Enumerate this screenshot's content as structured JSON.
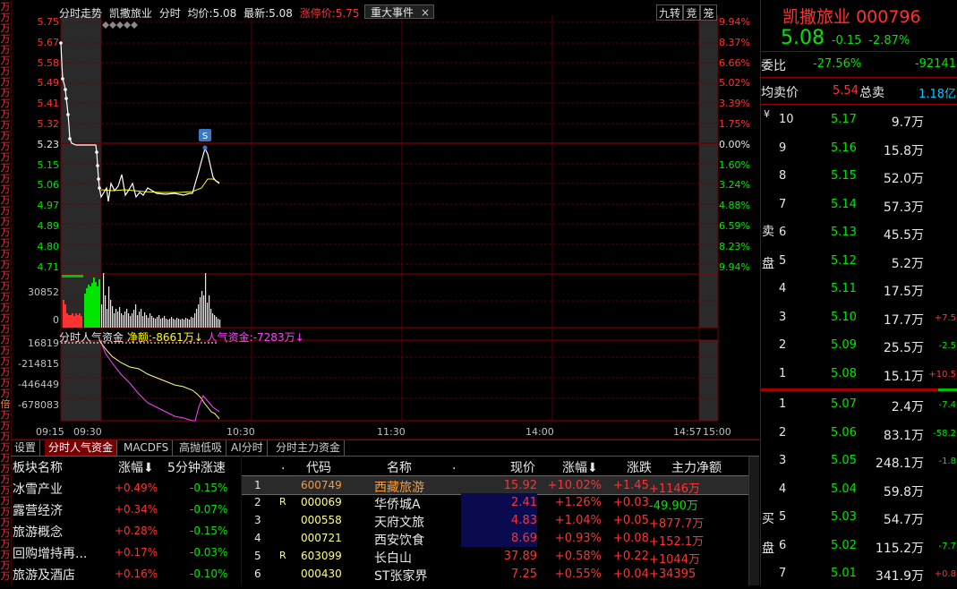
{
  "left_strip": [
    "万",
    "万",
    "万",
    "万",
    "万",
    "万",
    "万",
    "万",
    "万",
    "万",
    "万",
    "万",
    "万",
    "万",
    "万",
    "万",
    "万",
    "万",
    "万",
    "万",
    "万",
    "万",
    "万",
    "万",
    "万",
    "万",
    "万",
    "万",
    "万",
    "万",
    "万",
    "万",
    "万",
    "万",
    "万",
    "万",
    "万",
    "倍",
    "万",
    "万",
    "万",
    "万",
    "万",
    "万",
    "万",
    "万",
    "万",
    "万",
    "万",
    "万",
    "万",
    "万",
    "万",
    "万"
  ],
  "header": {
    "view": "分时走势",
    "stock_name": "凯撒旅业",
    "mode": "分时",
    "avg_label": "均价:",
    "avg_value": "5.08",
    "last_label": "最新:",
    "last_value": "5.08",
    "limit_label": "涨停价:",
    "limit_value": "5.75"
  },
  "event_tab": {
    "label": "重大事件",
    "close": "×"
  },
  "top_buttons": [
    "九转",
    "竞",
    "笼"
  ],
  "price_axis": [
    "5.75",
    "5.67",
    "5.58",
    "5.49",
    "5.41",
    "5.32",
    "5.23",
    "5.15",
    "5.06",
    "4.97",
    "4.89",
    "4.80",
    "4.71"
  ],
  "pct_axis": [
    "9.94%",
    "8.37%",
    "6.66%",
    "5.02%",
    "3.39%",
    "1.75%",
    "0.00%",
    "1.60%",
    "3.24%",
    "4.88%",
    "6.59%",
    "8.23%",
    "9.94%"
  ],
  "volume_axis": [
    "30852",
    "0"
  ],
  "signal_marker": "S",
  "fund_header": {
    "title": "分时人气资金",
    "net_label": "净额:",
    "net_value": "-8661万↓",
    "pop_label": "人气资金:",
    "pop_value": "-7283万↓"
  },
  "fund_axis": [
    "16819",
    "-214815",
    "-446449",
    "-678083"
  ],
  "time_axis": [
    "09:15",
    "09:30",
    "10:30",
    "11:30",
    "14:00",
    "14:57",
    "15:00"
  ],
  "quote": {
    "name": "凯撒旅业",
    "code": "000796",
    "price": "5.08",
    "change": "-0.15",
    "change_pct": "-2.87%",
    "weibi_label": "委比",
    "weibi_value": "-27.56%",
    "weicha_value": "-92141",
    "avg_sell_label": "均卖价",
    "avg_sell_value": "5.54",
    "total_sell_label": "总卖",
    "total_sell_value": "1.18亿",
    "sell_side_labels": [
      "¥",
      "卖",
      "盘"
    ],
    "buy_side_labels": [
      "买",
      "盘"
    ],
    "asks": [
      {
        "level": "10",
        "price": "5.17",
        "vol": "9.7万",
        "chg": ""
      },
      {
        "level": "9",
        "price": "5.16",
        "vol": "15.8万",
        "chg": ""
      },
      {
        "level": "8",
        "price": "5.15",
        "vol": "52.0万",
        "chg": ""
      },
      {
        "level": "7",
        "price": "5.14",
        "vol": "57.3万",
        "chg": ""
      },
      {
        "level": "6",
        "price": "5.13",
        "vol": "45.5万",
        "chg": ""
      },
      {
        "level": "5",
        "price": "5.12",
        "vol": "5.2万",
        "chg": ""
      },
      {
        "level": "4",
        "price": "5.11",
        "vol": "17.5万",
        "chg": ""
      },
      {
        "level": "3",
        "price": "5.10",
        "vol": "17.7万",
        "chg": "+7.5"
      },
      {
        "level": "2",
        "price": "5.09",
        "vol": "25.5万",
        "chg": "-2.5"
      },
      {
        "level": "1",
        "price": "5.08",
        "vol": "15.1万",
        "chg": "+10.5"
      }
    ],
    "bids": [
      {
        "level": "1",
        "price": "5.07",
        "vol": "2.4万",
        "chg": "-7.4"
      },
      {
        "level": "2",
        "price": "5.06",
        "vol": "83.1万",
        "chg": "-58.2"
      },
      {
        "level": "3",
        "price": "5.05",
        "vol": "248.1万",
        "chg": "-1.8"
      },
      {
        "level": "4",
        "price": "5.04",
        "vol": "59.8万",
        "chg": ""
      },
      {
        "level": "5",
        "price": "5.03",
        "vol": "54.7万",
        "chg": ""
      },
      {
        "level": "6",
        "price": "5.02",
        "vol": "115.2万",
        "chg": "-7.7"
      },
      {
        "level": "7",
        "price": "5.01",
        "vol": "341.9万",
        "chg": "+0.8"
      }
    ]
  },
  "bottom_tabs": [
    "设置",
    "分时人气资金",
    "MACDFS",
    "高抛低吸",
    "AI分时",
    "分时主力资金"
  ],
  "sectors": {
    "headers": [
      "板块名称",
      "涨幅⬇",
      "5分钟涨速"
    ],
    "rows": [
      {
        "name": "冰雪产业",
        "pct": "+0.49%",
        "speed": "-0.15%"
      },
      {
        "name": "露营经济",
        "pct": "+0.34%",
        "speed": "-0.07%"
      },
      {
        "name": "旅游概念",
        "pct": "+0.28%",
        "speed": "-0.15%"
      },
      {
        "name": "回购增持再...",
        "pct": "+0.17%",
        "speed": "-0.03%"
      },
      {
        "name": "旅游及酒店",
        "pct": "+0.16%",
        "speed": "-0.10%"
      }
    ]
  },
  "stocks": {
    "headers": [
      ".",
      "代码",
      "名称",
      ".",
      "现价",
      "涨幅⬇",
      "涨跌",
      "主力净额"
    ],
    "rows": [
      {
        "idx": "1",
        "flag": "",
        "code": "600749",
        "name": "西藏旅游",
        "price": "15.92",
        "pct": "+10.02%",
        "chg": "+1.45",
        "net": "+1146万"
      },
      {
        "idx": "2",
        "flag": "R",
        "code": "000069",
        "name": "华侨城A",
        "price": "2.41",
        "pct": "+1.26%",
        "chg": "+0.03",
        "net": "-49.90万"
      },
      {
        "idx": "3",
        "flag": "",
        "code": "000558",
        "name": "天府文旅",
        "price": "4.83",
        "pct": "+1.04%",
        "chg": "+0.05",
        "net": "+877.7万"
      },
      {
        "idx": "4",
        "flag": "",
        "code": "000721",
        "name": "西安饮食",
        "price": "8.69",
        "pct": "+0.93%",
        "chg": "+0.08",
        "net": "+152.1万"
      },
      {
        "idx": "5",
        "flag": "R",
        "code": "603099",
        "name": "长白山",
        "price": "37.89",
        "pct": "+0.58%",
        "chg": "+0.22",
        "net": "+1044万"
      },
      {
        "idx": "6",
        "flag": "",
        "code": "000430",
        "name": "ST张家界",
        "price": "7.25",
        "pct": "+0.55%",
        "chg": "+0.04",
        "net": "+34395"
      }
    ]
  },
  "colors": {
    "up": "#ff3232",
    "down": "#00e600",
    "grid": "#8b0000",
    "price_line": "#ffffff",
    "avg_line": "#ffff00",
    "fund_line": "#ff40ff"
  }
}
